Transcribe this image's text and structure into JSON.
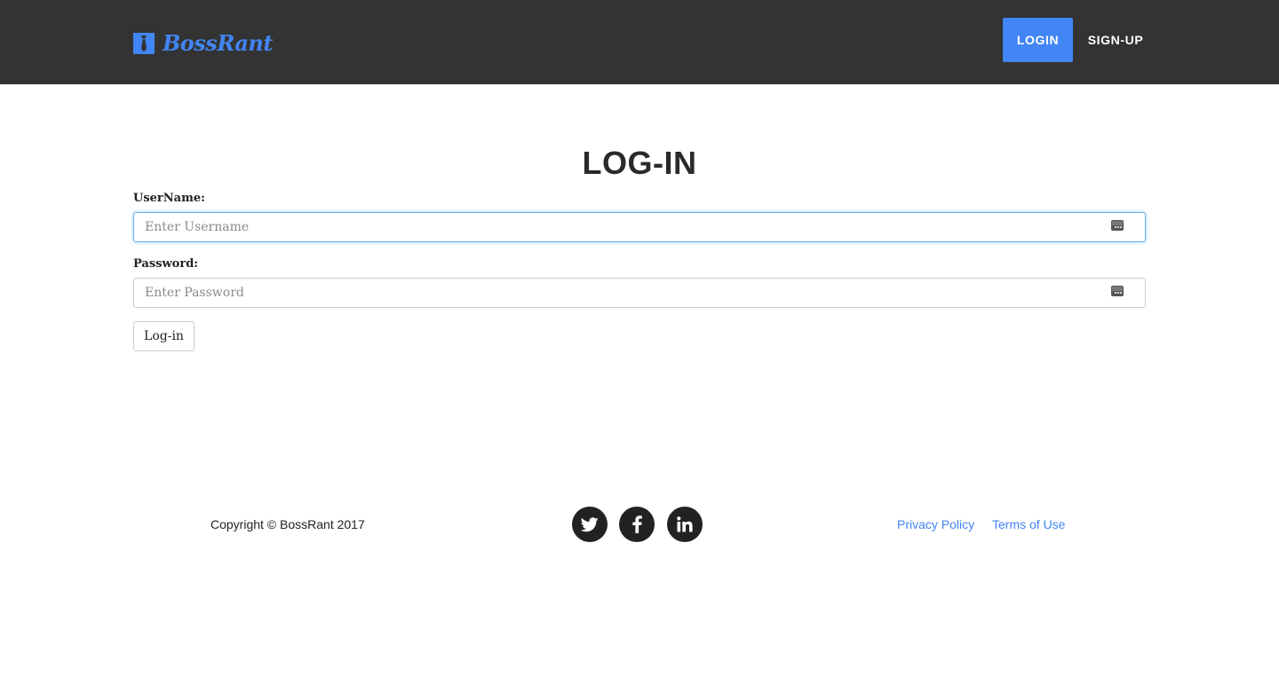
{
  "navbar": {
    "brand_name": "BossRant",
    "login_label": "LOGIN",
    "signup_label": "SIGN-UP",
    "accent_color": "#4285f4",
    "background_color": "#333333"
  },
  "login_form": {
    "title": "LOG-IN",
    "username_label": "UserName:",
    "username_placeholder": "Enter Username",
    "password_label": "Password:",
    "password_placeholder": "Enter Password",
    "submit_label": "Log-in"
  },
  "footer": {
    "copyright": "Copyright © BossRant 2017",
    "social_icons": [
      "twitter-icon",
      "facebook-icon",
      "linkedin-icon"
    ],
    "links": {
      "privacy": "Privacy Policy",
      "terms": "Terms of Use"
    }
  }
}
